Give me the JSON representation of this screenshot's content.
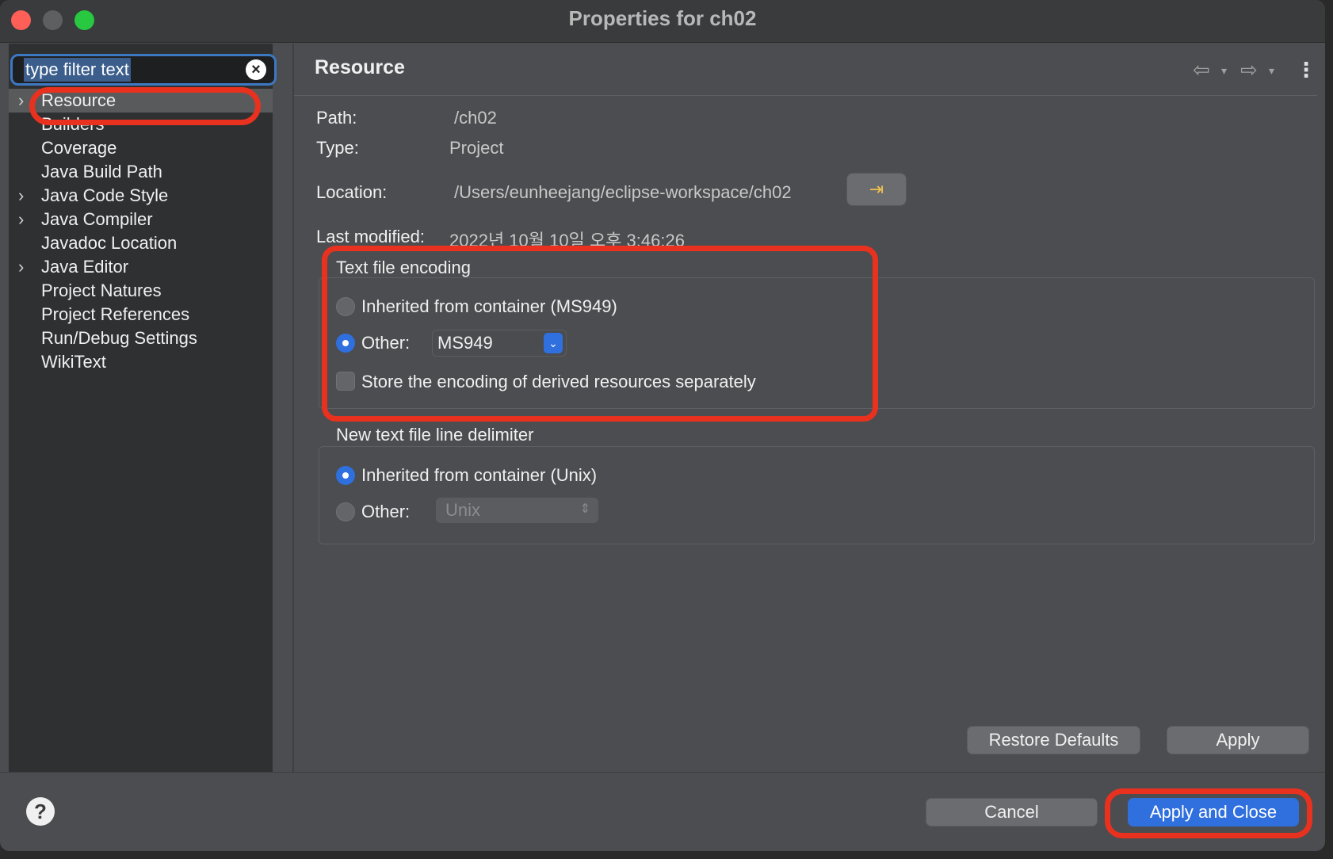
{
  "window": {
    "title": "Properties for ch02"
  },
  "filter": {
    "text": "type filter text"
  },
  "tree": {
    "items": [
      {
        "label": "Resource",
        "expandable": true,
        "selected": true
      },
      {
        "label": "Builders",
        "expandable": false
      },
      {
        "label": "Coverage",
        "expandable": false
      },
      {
        "label": "Java Build Path",
        "expandable": false
      },
      {
        "label": "Java Code Style",
        "expandable": true
      },
      {
        "label": "Java Compiler",
        "expandable": true
      },
      {
        "label": "Javadoc Location",
        "expandable": false
      },
      {
        "label": "Java Editor",
        "expandable": true
      },
      {
        "label": "Project Natures",
        "expandable": false
      },
      {
        "label": "Project References",
        "expandable": false
      },
      {
        "label": "Run/Debug Settings",
        "expandable": false
      },
      {
        "label": "WikiText",
        "expandable": false
      }
    ]
  },
  "main": {
    "title": "Resource",
    "path_label": "Path:",
    "path_value": "/ch02",
    "type_label": "Type:",
    "type_value": "Project",
    "location_label": "Location:",
    "location_value": "/Users/eunheejang/eclipse-workspace/ch02",
    "modified_label": "Last modified:",
    "modified_value": "2022년 10월 10일 오후 3:46:26"
  },
  "encoding": {
    "group_label": "Text file encoding",
    "inherited_label": "Inherited from container (MS949)",
    "other_label": "Other:",
    "other_value": "MS949",
    "store_label": "Store the encoding of derived resources separately"
  },
  "delimiter": {
    "group_label": "New text file line delimiter",
    "inherited_label": "Inherited from container (Unix)",
    "other_label": "Other:",
    "other_value": "Unix"
  },
  "buttons": {
    "restore_defaults": "Restore Defaults",
    "apply": "Apply",
    "cancel": "Cancel",
    "apply_close": "Apply and Close"
  },
  "help": {
    "glyph": "?"
  },
  "colors": {
    "accent": "#2f6fde",
    "annotation": "#e8321f",
    "background": "#4b4d50"
  }
}
